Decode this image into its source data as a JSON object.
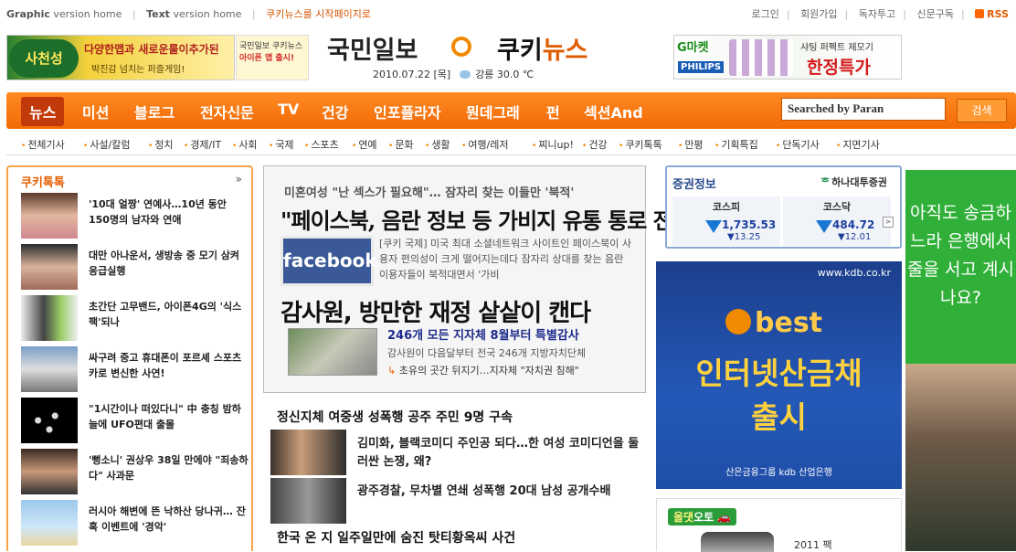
{
  "util": {
    "graphic_label": "Graphic",
    "graphic_suffix": "version home",
    "text_label": "Text",
    "text_suffix": "version home",
    "set_home": "쿠키뉴스를 시작페이지로",
    "login": "로그인",
    "join": "회원가입",
    "report": "독자투고",
    "subscribe": "신문구독",
    "rss": "RSS"
  },
  "header": {
    "ad_left_badge": "사천성",
    "ad_left_line1": "다양한맵과 새로운룰이추가된",
    "ad_left_line2": "박진감 넘치는 퍼즐게임!",
    "ad_left2_line1": "국민일보 쿠키뉴스",
    "ad_left2_line2": "아이폰 앱 출시!",
    "logo_kmib": "국민일보",
    "logo_kuki_a": "쿠키",
    "logo_kuki_b": "뉴스",
    "date": "2010.07.22 [목]",
    "weather": "강릉 30.0 ℃",
    "ad_right_gmarket": "G마켓",
    "ad_right_philips": "PHILIPS",
    "ad_right_line1": "샤팅 퍼펙트 제모기",
    "ad_right_line2": "한정특가"
  },
  "nav": {
    "items": [
      "뉴스",
      "미션",
      "블로그",
      "전자신문",
      "TV",
      "건강",
      "인포플라자",
      "뭔데그래",
      "펀",
      "섹션And"
    ],
    "search_placeholder": "Searched by Paran",
    "search_button": "검색"
  },
  "subnav": [
    "전체기사",
    "사설/칼럼",
    "정치",
    "경제/IT",
    "사회",
    "국제",
    "스포츠",
    "연예",
    "문화",
    "생활",
    "여행/레저",
    "찌니up!",
    "건강",
    "쿠키톡톡",
    "만평",
    "기획특집",
    "단독기사",
    "지면기사"
  ],
  "left": {
    "title": "쿠키톡톡",
    "more": "»",
    "items": [
      "'10대 얼짱' 연예사…10년 동안 150명의 남자와 연애",
      "대만 아나운서, 생방송 중 모기 삼켜 응급실행",
      "초간단 고무밴드, 아이폰4G의 '식스팩'되나",
      "싸구려 중고 휴대폰이 포르셰 스포츠카로 변신한 사연!",
      "\"1시간이나 떠있다니\" 中 충칭 밤하늘에 UFO편대 출몰",
      "'뻥소니' 권상우 38일 만에야 \"죄송하다\" 사과문",
      "러시아 해변에 뜬 낙하산 당나귀… 잔혹 이벤트에 '경악'"
    ]
  },
  "center": {
    "sub": "미혼여성 \"난 섹스가 필요해\"… 잠자리 찾는 이들만 '북적'",
    "headline": "\"페이스북, 음란 정보 등 가비지 유통 통로 전락\"",
    "fb_logo": "facebook",
    "fb_text": "[쿠키 국제] 미국 최대 소셜네트워크 사이트인 페이스북이 사용자 편의성이 크게 떨어지는데다 잠자리 상대를 찾는 음란 이용자들이 북적대면서 '가비",
    "headline2": "감사원, 방만한 재정 샅샅이 캔다",
    "bold2": "246개 모든 지자체 8월부터 특별감사",
    "text2": "감사원이 다음달부터 전국 246개 지방자치단체",
    "link2": "초유의 곳간 뒤지기…지자체 \"자치권 침해\"",
    "list1": "정신지체 여중생 성폭행 공주 주민 9명 구속",
    "item1": "김미화, 블랙코미디 주인공 되다…한 여성 코미디언을 둘러싼 논쟁, 왜?",
    "item2": "광주경찰, 무차별 연쇄 성폭행 20대 남성 공개수배",
    "list_last": "한국 온 지 일주일만에 숨진 탓티황옥씨 사건"
  },
  "right": {
    "stock_title": "증권정보",
    "stock_brand": "하나대투증권",
    "kospi_name": "코스피",
    "kospi_value": "1,735.53",
    "kospi_change": "▼13.25",
    "kosdaq_name": "코스닥",
    "kosdaq_value": "484.72",
    "kosdaq_change": "▼12.01",
    "kdb_url": "www.kdb.co.kr",
    "kdb_best": "best",
    "kdb_line1": "인터넷산금채",
    "kdb_line2": "출시",
    "kdb_foot": "산은금융그룹 kdb 산업은행",
    "auto_tag_a": "올댓",
    "auto_tag_b": "오토",
    "auto_caption": "2011 팩"
  },
  "green_ad": {
    "text": "아직도 송금하느라 은행에서 줄을 서고 계시나요?"
  }
}
